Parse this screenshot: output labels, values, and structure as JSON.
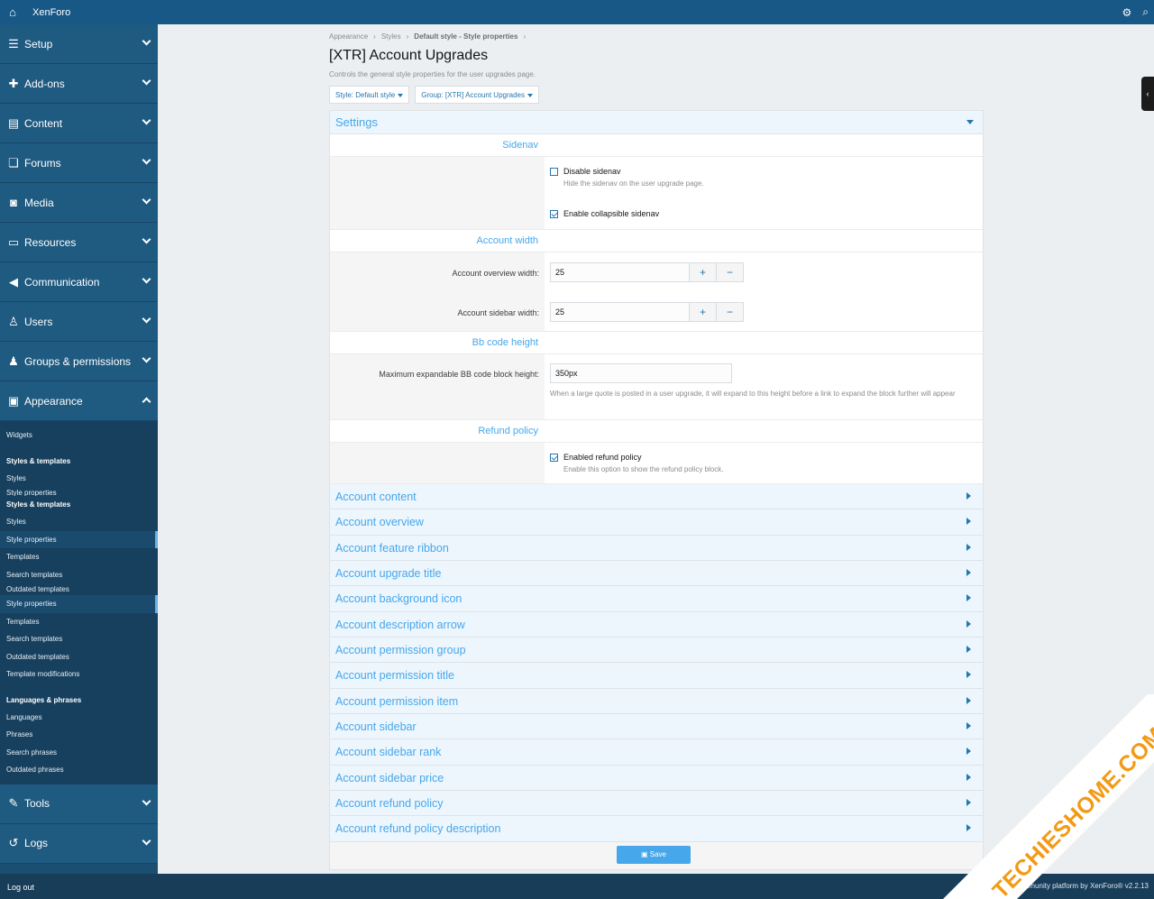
{
  "topbar": {
    "brand": "XenForo"
  },
  "sidebar": {
    "sections": [
      {
        "label": "Setup",
        "icon": "sliders-icon"
      },
      {
        "label": "Add-ons",
        "icon": "puzzle-icon"
      },
      {
        "label": "Content",
        "icon": "content-icon"
      },
      {
        "label": "Forums",
        "icon": "comments-icon"
      },
      {
        "label": "Media",
        "icon": "camera-icon"
      },
      {
        "label": "Resources",
        "icon": "drive-icon"
      },
      {
        "label": "Communication",
        "icon": "bullhorn-icon"
      },
      {
        "label": "Users",
        "icon": "user-icon"
      },
      {
        "label": "Groups & permissions",
        "icon": "users-icon"
      },
      {
        "label": "Appearance",
        "icon": "image-icon"
      }
    ],
    "appearance_items": {
      "widgets": "Widgets",
      "head1": "Styles & templates",
      "styles1": "Styles",
      "sp_cut": "Style properties",
      "head2": "Styles & templates",
      "styles2": "Styles",
      "style_props": "Style properties",
      "templates": "Templates",
      "search_templates": "Search templates",
      "outdated_cut": "Outdated templates",
      "style_props2": "Style properties",
      "templates2": "Templates",
      "search_templates2": "Search templates",
      "outdated_templates": "Outdated templates",
      "template_mods": "Template modifications",
      "head3": "Languages & phrases",
      "languages": "Languages",
      "phrases": "Phrases",
      "search_phrases": "Search phrases",
      "outdated_phrases": "Outdated phrases"
    },
    "tools": "Tools",
    "logs": "Logs"
  },
  "footer": {
    "logout": "Log out",
    "credit": "Community platform by XenForo® v2.2.13"
  },
  "breadcrumb": {
    "a": "Appearance",
    "b": "Styles",
    "c": "Default style - Style properties"
  },
  "page": {
    "title": "[XTR] Account Upgrades",
    "description": "Controls the general style properties for the user upgrades page.",
    "style_filter": "Style: Default style",
    "group_filter": "Group: [XTR] Account Upgrades"
  },
  "settings": {
    "title": "Settings",
    "sidenav": {
      "group": "Sidenav",
      "disable_label": "Disable sidenav",
      "disable_hint": "Hide the sidenav on the user upgrade page.",
      "collapsible_label": "Enable collapsible sidenav"
    },
    "width": {
      "group": "Account width",
      "overview_label": "Account overview width:",
      "overview_value": "25",
      "sidebar_label": "Account sidebar width:",
      "sidebar_value": "25"
    },
    "bbcode": {
      "group": "Bb code height",
      "label": "Maximum expandable BB code block height:",
      "value": "350px",
      "hint": "When a large quote is posted in a user upgrade, it will expand to this height before a link to expand the block further will appear"
    },
    "refund": {
      "group": "Refund policy",
      "label": "Enabled refund policy",
      "hint": "Enable this option to show the refund policy block."
    }
  },
  "collapsed_groups": [
    "Account content",
    "Account overview",
    "Account feature ribbon",
    "Account upgrade title",
    "Account background icon",
    "Account description arrow",
    "Account permission group",
    "Account permission title",
    "Account permission item",
    "Account sidebar",
    "Account sidebar rank",
    "Account sidebar price",
    "Account refund policy",
    "Account refund policy description"
  ],
  "save_label": "Save",
  "watermark": "TECHIESHOME.COM"
}
